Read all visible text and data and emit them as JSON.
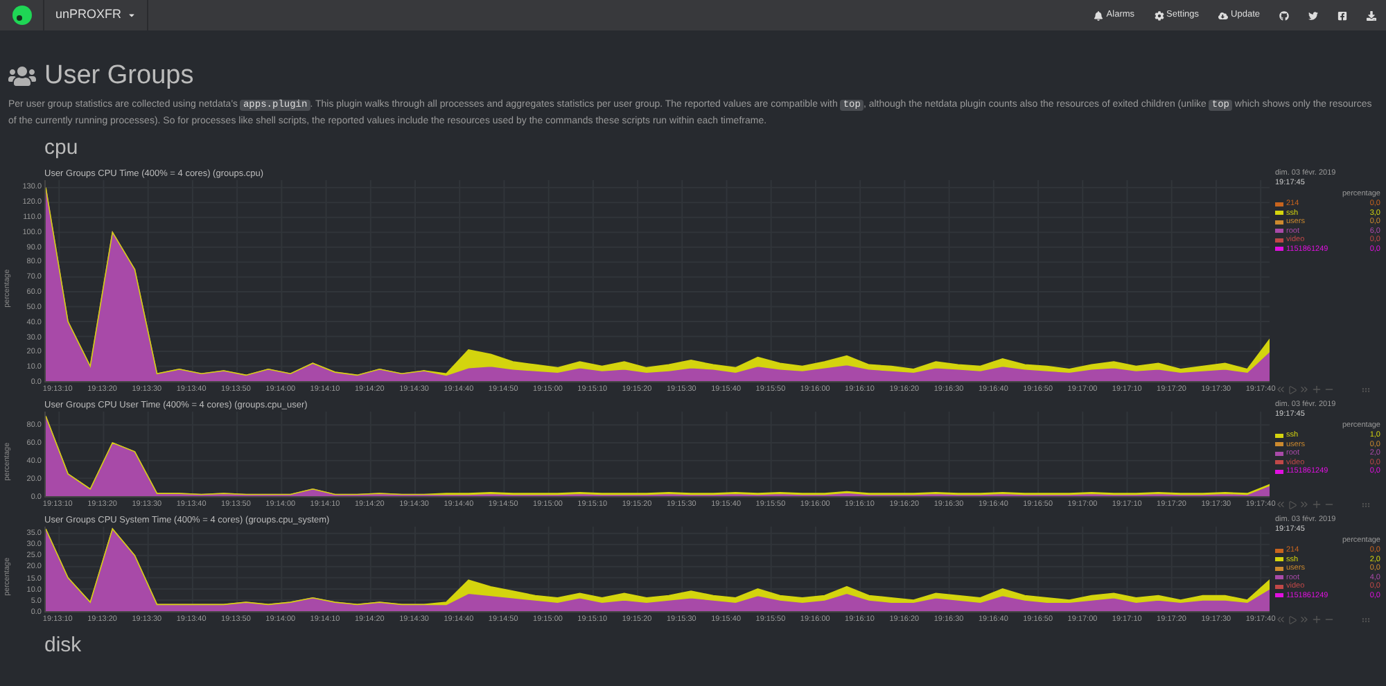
{
  "navbar": {
    "host": "unPROXFR",
    "links": [
      {
        "kind": "alarms",
        "label": "Alarms"
      },
      {
        "kind": "settings",
        "label": "Settings"
      },
      {
        "kind": "update",
        "label": "Update"
      }
    ]
  },
  "page": {
    "title": "User Groups",
    "description": [
      {
        "kind": "text",
        "text": "Per user group statistics are collected using netdata's "
      },
      {
        "kind": "code",
        "text": "apps.plugin"
      },
      {
        "kind": "text",
        "text": ". This plugin walks through all processes and aggregates statistics per user group. The reported values are compatible with "
      },
      {
        "kind": "code",
        "text": "top"
      },
      {
        "kind": "text",
        "text": ", although the netdata plugin counts also the resources of exited children (unlike "
      },
      {
        "kind": "code",
        "text": "top"
      },
      {
        "kind": "text",
        "text": " which shows only the resources of the currently running processes). So for processes like shell scripts, the reported values include the resources used by the commands these scripts run within each timeframe."
      }
    ]
  },
  "sections": [
    {
      "heading": "cpu",
      "charts": [
        {
          "title": "User Groups CPU Time (400% = 4 cores) (groups.cpu)",
          "date": "dim. 03 févr. 2019",
          "time": "19:17:45",
          "unit": "percentage",
          "legend": [
            {
              "kind": "static",
              "name": "214",
              "color": "#c8641e",
              "value": "0,0"
            },
            {
              "kind": "series",
              "value": "3,0"
            },
            {
              "kind": "static",
              "name": "users",
              "color": "#cc8a2e",
              "value": "0,0"
            },
            {
              "kind": "series",
              "value": "6,0"
            },
            {
              "kind": "static",
              "name": "video",
              "color": "#c04848",
              "value": "0,0"
            },
            {
              "kind": "static",
              "name": "1151861249",
              "color": "#e010e0",
              "value": "0,0"
            }
          ],
          "chart_data": {
            "type": "area",
            "stacked": true,
            "grid": true,
            "legend": "right",
            "ylabel": "percentage",
            "xlim": [
              69187,
              69462
            ],
            "ylim": [
              0,
              135
            ],
            "x": [
              69187,
              69192,
              69197,
              69202,
              69207,
              69212,
              69217,
              69222,
              69227,
              69232,
              69237,
              69242,
              69247,
              69252,
              69257,
              69262,
              69267,
              69272,
              69277,
              69282,
              69287,
              69292,
              69297,
              69302,
              69307,
              69312,
              69317,
              69322,
              69327,
              69332,
              69337,
              69342,
              69347,
              69352,
              69357,
              69362,
              69367,
              69372,
              69377,
              69382,
              69387,
              69392,
              69397,
              69402,
              69407,
              69412,
              69417,
              69422,
              69427,
              69432,
              69437,
              69442,
              69447,
              69452,
              69457,
              69462
            ],
            "xticks": [
              {
                "value": 69190,
                "label": "19:13:10"
              },
              {
                "value": 69200,
                "label": "19:13:20"
              },
              {
                "value": 69210,
                "label": "19:13:30"
              },
              {
                "value": 69220,
                "label": "19:13:40"
              },
              {
                "value": 69230,
                "label": "19:13:50"
              },
              {
                "value": 69240,
                "label": "19:14:00"
              },
              {
                "value": 69250,
                "label": "19:14:10"
              },
              {
                "value": 69260,
                "label": "19:14:20"
              },
              {
                "value": 69270,
                "label": "19:14:30"
              },
              {
                "value": 69280,
                "label": "19:14:40"
              },
              {
                "value": 69290,
                "label": "19:14:50"
              },
              {
                "value": 69300,
                "label": "19:15:00"
              },
              {
                "value": 69310,
                "label": "19:15:10"
              },
              {
                "value": 69320,
                "label": "19:15:20"
              },
              {
                "value": 69330,
                "label": "19:15:30"
              },
              {
                "value": 69340,
                "label": "19:15:40"
              },
              {
                "value": 69350,
                "label": "19:15:50"
              },
              {
                "value": 69360,
                "label": "19:16:00"
              },
              {
                "value": 69370,
                "label": "19:16:10"
              },
              {
                "value": 69380,
                "label": "19:16:20"
              },
              {
                "value": 69390,
                "label": "19:16:30"
              },
              {
                "value": 69400,
                "label": "19:16:40"
              },
              {
                "value": 69410,
                "label": "19:16:50"
              },
              {
                "value": 69420,
                "label": "19:17:00"
              },
              {
                "value": 69430,
                "label": "19:17:10"
              },
              {
                "value": 69440,
                "label": "19:17:20"
              },
              {
                "value": 69450,
                "label": "19:17:30"
              },
              {
                "value": 69460,
                "label": "19:17:40"
              }
            ],
            "yticks": [
              {
                "value": 0,
                "label": "0.0"
              },
              {
                "value": 10,
                "label": "10.0"
              },
              {
                "value": 20,
                "label": "20.0"
              },
              {
                "value": 30,
                "label": "30.0"
              },
              {
                "value": 40,
                "label": "40.0"
              },
              {
                "value": 50,
                "label": "50.0"
              },
              {
                "value": 60,
                "label": "60.0"
              },
              {
                "value": 70,
                "label": "70.0"
              },
              {
                "value": 80,
                "label": "80.0"
              },
              {
                "value": 90,
                "label": "90.0"
              },
              {
                "value": 100,
                "label": "100.0"
              },
              {
                "value": 110,
                "label": "110.0"
              },
              {
                "value": 120,
                "label": "120.0"
              },
              {
                "value": 130,
                "label": "130.0"
              }
            ],
            "series": [
              {
                "name": "ssh",
                "color": "#d4d40e",
                "values": [
                  0,
                  0,
                  0,
                  0,
                  0,
                  0,
                  0,
                  0,
                  0,
                  0,
                  0,
                  0,
                  0,
                  0,
                  0,
                  0,
                  0,
                  0,
                  1,
                  12,
                  8,
                  5,
                  4,
                  3,
                  4,
                  3,
                  5,
                  3,
                  4,
                  5,
                  3,
                  3,
                  6,
                  4,
                  3,
                  4,
                  6,
                  3,
                  3,
                  2,
                  4,
                  3,
                  3,
                  5,
                  3,
                  3,
                  2,
                  3,
                  4,
                  3,
                  4,
                  2,
                  3,
                  4,
                  2,
                  8
                ]
              },
              {
                "name": "root",
                "color": "#a84aa8",
                "values": [
                  130,
                  40,
                  10,
                  100,
                  75,
                  5,
                  8,
                  5,
                  7,
                  4,
                  8,
                  5,
                  12,
                  6,
                  4,
                  8,
                  5,
                  7,
                  4,
                  9,
                  10,
                  8,
                  7,
                  6,
                  9,
                  7,
                  8,
                  6,
                  7,
                  9,
                  8,
                  6,
                  10,
                  8,
                  7,
                  9,
                  11,
                  8,
                  7,
                  6,
                  9,
                  8,
                  7,
                  10,
                  8,
                  7,
                  6,
                  8,
                  9,
                  7,
                  8,
                  6,
                  7,
                  8,
                  6,
                  20
                ]
              }
            ]
          }
        },
        {
          "title": "User Groups CPU User Time (400% = 4 cores) (groups.cpu_user)",
          "date": "dim. 03 févr. 2019",
          "time": "19:17:45",
          "unit": "percentage",
          "legend": [
            {
              "kind": "series",
              "value": "1,0"
            },
            {
              "kind": "static",
              "name": "users",
              "color": "#cc8a2e",
              "value": "0,0"
            },
            {
              "kind": "series",
              "value": "2,0"
            },
            {
              "kind": "static",
              "name": "video",
              "color": "#c04848",
              "value": "0,0"
            },
            {
              "kind": "static",
              "name": "1151861249",
              "color": "#e010e0",
              "value": "0,0"
            }
          ],
          "chart_data": {
            "type": "area",
            "stacked": true,
            "grid": true,
            "legend": "right",
            "ylabel": "percentage",
            "xlim": [
              69187,
              69462
            ],
            "ylim": [
              0,
              95
            ],
            "x": [
              69187,
              69192,
              69197,
              69202,
              69207,
              69212,
              69217,
              69222,
              69227,
              69232,
              69237,
              69242,
              69247,
              69252,
              69257,
              69262,
              69267,
              69272,
              69277,
              69282,
              69287,
              69292,
              69297,
              69302,
              69307,
              69312,
              69317,
              69322,
              69327,
              69332,
              69337,
              69342,
              69347,
              69352,
              69357,
              69362,
              69367,
              69372,
              69377,
              69382,
              69387,
              69392,
              69397,
              69402,
              69407,
              69412,
              69417,
              69422,
              69427,
              69432,
              69437,
              69442,
              69447,
              69452,
              69457,
              69462
            ],
            "xticks": [
              {
                "value": 69190,
                "label": "19:13:10"
              },
              {
                "value": 69200,
                "label": "19:13:20"
              },
              {
                "value": 69210,
                "label": "19:13:30"
              },
              {
                "value": 69220,
                "label": "19:13:40"
              },
              {
                "value": 69230,
                "label": "19:13:50"
              },
              {
                "value": 69240,
                "label": "19:14:00"
              },
              {
                "value": 69250,
                "label": "19:14:10"
              },
              {
                "value": 69260,
                "label": "19:14:20"
              },
              {
                "value": 69270,
                "label": "19:14:30"
              },
              {
                "value": 69280,
                "label": "19:14:40"
              },
              {
                "value": 69290,
                "label": "19:14:50"
              },
              {
                "value": 69300,
                "label": "19:15:00"
              },
              {
                "value": 69310,
                "label": "19:15:10"
              },
              {
                "value": 69320,
                "label": "19:15:20"
              },
              {
                "value": 69330,
                "label": "19:15:30"
              },
              {
                "value": 69340,
                "label": "19:15:40"
              },
              {
                "value": 69350,
                "label": "19:15:50"
              },
              {
                "value": 69360,
                "label": "19:16:00"
              },
              {
                "value": 69370,
                "label": "19:16:10"
              },
              {
                "value": 69380,
                "label": "19:16:20"
              },
              {
                "value": 69390,
                "label": "19:16:30"
              },
              {
                "value": 69400,
                "label": "19:16:40"
              },
              {
                "value": 69410,
                "label": "19:16:50"
              },
              {
                "value": 69420,
                "label": "19:17:00"
              },
              {
                "value": 69430,
                "label": "19:17:10"
              },
              {
                "value": 69440,
                "label": "19:17:20"
              },
              {
                "value": 69450,
                "label": "19:17:30"
              },
              {
                "value": 69460,
                "label": "19:17:40"
              }
            ],
            "yticks": [
              {
                "value": 0,
                "label": "0.0"
              },
              {
                "value": 20,
                "label": "20.0"
              },
              {
                "value": 40,
                "label": "40.0"
              },
              {
                "value": 60,
                "label": "60.0"
              },
              {
                "value": 80,
                "label": "80.0"
              }
            ],
            "series": [
              {
                "name": "ssh",
                "color": "#d4d40e",
                "values": [
                  0,
                  0,
                  0,
                  0,
                  0,
                  0,
                  0,
                  0,
                  0,
                  0,
                  0,
                  0,
                  0,
                  0,
                  0,
                  0,
                  0,
                  0,
                  1,
                  1,
                  1,
                  1,
                  1,
                  1,
                  1,
                  1,
                  1,
                  1,
                  1,
                  1,
                  1,
                  1,
                  1,
                  1,
                  1,
                  1,
                  1,
                  1,
                  1,
                  1,
                  1,
                  1,
                  1,
                  1,
                  1,
                  1,
                  1,
                  1,
                  1,
                  1,
                  1,
                  1,
                  1,
                  1,
                  1,
                  1
                ]
              },
              {
                "name": "root",
                "color": "#a84aa8",
                "values": [
                  90,
                  25,
                  8,
                  60,
                  50,
                  3,
                  3,
                  2,
                  3,
                  2,
                  2,
                  2,
                  8,
                  2,
                  2,
                  3,
                  2,
                  2,
                  2,
                  2,
                  3,
                  2,
                  2,
                  2,
                  3,
                  2,
                  2,
                  2,
                  3,
                  2,
                  2,
                  3,
                  2,
                  3,
                  2,
                  2,
                  4,
                  2,
                  2,
                  2,
                  3,
                  2,
                  2,
                  3,
                  2,
                  2,
                  2,
                  3,
                  2,
                  2,
                  3,
                  2,
                  2,
                  3,
                  2,
                  12
                ]
              }
            ]
          }
        },
        {
          "title": "User Groups CPU System Time (400% = 4 cores) (groups.cpu_system)",
          "date": "dim. 03 févr. 2019",
          "time": "19:17:45",
          "unit": "percentage",
          "legend": [
            {
              "kind": "static",
              "name": "214",
              "color": "#c8641e",
              "value": "0,0"
            },
            {
              "kind": "series",
              "value": "2,0"
            },
            {
              "kind": "static",
              "name": "users",
              "color": "#cc8a2e",
              "value": "0,0"
            },
            {
              "kind": "series",
              "value": "4,0"
            },
            {
              "kind": "static",
              "name": "video",
              "color": "#c04848",
              "value": "0,0"
            },
            {
              "kind": "static",
              "name": "1151861249",
              "color": "#e010e0",
              "value": "0,0"
            }
          ],
          "chart_data": {
            "type": "area",
            "stacked": true,
            "grid": true,
            "legend": "right",
            "ylabel": "percentage",
            "xlim": [
              69187,
              69462
            ],
            "ylim": [
              0,
              38
            ],
            "x": [
              69187,
              69192,
              69197,
              69202,
              69207,
              69212,
              69217,
              69222,
              69227,
              69232,
              69237,
              69242,
              69247,
              69252,
              69257,
              69262,
              69267,
              69272,
              69277,
              69282,
              69287,
              69292,
              69297,
              69302,
              69307,
              69312,
              69317,
              69322,
              69327,
              69332,
              69337,
              69342,
              69347,
              69352,
              69357,
              69362,
              69367,
              69372,
              69377,
              69382,
              69387,
              69392,
              69397,
              69402,
              69407,
              69412,
              69417,
              69422,
              69427,
              69432,
              69437,
              69442,
              69447,
              69452,
              69457,
              69462
            ],
            "xticks": [
              {
                "value": 69190,
                "label": "19:13:10"
              },
              {
                "value": 69200,
                "label": "19:13:20"
              },
              {
                "value": 69210,
                "label": "19:13:30"
              },
              {
                "value": 69220,
                "label": "19:13:40"
              },
              {
                "value": 69230,
                "label": "19:13:50"
              },
              {
                "value": 69240,
                "label": "19:14:00"
              },
              {
                "value": 69250,
                "label": "19:14:10"
              },
              {
                "value": 69260,
                "label": "19:14:20"
              },
              {
                "value": 69270,
                "label": "19:14:30"
              },
              {
                "value": 69280,
                "label": "19:14:40"
              },
              {
                "value": 69290,
                "label": "19:14:50"
              },
              {
                "value": 69300,
                "label": "19:15:00"
              },
              {
                "value": 69310,
                "label": "19:15:10"
              },
              {
                "value": 69320,
                "label": "19:15:20"
              },
              {
                "value": 69330,
                "label": "19:15:30"
              },
              {
                "value": 69340,
                "label": "19:15:40"
              },
              {
                "value": 69350,
                "label": "19:15:50"
              },
              {
                "value": 69360,
                "label": "19:16:00"
              },
              {
                "value": 69370,
                "label": "19:16:10"
              },
              {
                "value": 69380,
                "label": "19:16:20"
              },
              {
                "value": 69390,
                "label": "19:16:30"
              },
              {
                "value": 69400,
                "label": "19:16:40"
              },
              {
                "value": 69410,
                "label": "19:16:50"
              },
              {
                "value": 69420,
                "label": "19:17:00"
              },
              {
                "value": 69430,
                "label": "19:17:10"
              },
              {
                "value": 69440,
                "label": "19:17:20"
              },
              {
                "value": 69450,
                "label": "19:17:30"
              },
              {
                "value": 69460,
                "label": "19:17:40"
              }
            ],
            "yticks": [
              {
                "value": 0,
                "label": "0.0"
              },
              {
                "value": 5,
                "label": "5.0"
              },
              {
                "value": 10,
                "label": "10.0"
              },
              {
                "value": 15,
                "label": "15.0"
              },
              {
                "value": 20,
                "label": "20.0"
              },
              {
                "value": 25,
                "label": "25.0"
              },
              {
                "value": 30,
                "label": "30.0"
              },
              {
                "value": 35,
                "label": "35.0"
              }
            ],
            "series": [
              {
                "name": "ssh",
                "color": "#d4d40e",
                "values": [
                  0,
                  0,
                  0,
                  0,
                  0,
                  0,
                  0,
                  0,
                  0,
                  0,
                  0,
                  0,
                  0,
                  0,
                  0,
                  0,
                  0,
                  0,
                  1,
                  6,
                  4,
                  3,
                  2,
                  2,
                  2,
                  2,
                  3,
                  2,
                  2,
                  3,
                  2,
                  2,
                  3,
                  2,
                  2,
                  2,
                  3,
                  2,
                  2,
                  1,
                  2,
                  2,
                  2,
                  3,
                  2,
                  2,
                  1,
                  2,
                  2,
                  2,
                  2,
                  1,
                  2,
                  2,
                  1,
                  4
                ]
              },
              {
                "name": "root",
                "color": "#a84aa8",
                "values": [
                  37,
                  15,
                  4,
                  37,
                  25,
                  3,
                  3,
                  3,
                  3,
                  4,
                  3,
                  4,
                  6,
                  4,
                  3,
                  4,
                  3,
                  3,
                  3,
                  8,
                  7,
                  6,
                  5,
                  4,
                  6,
                  4,
                  5,
                  4,
                  5,
                  6,
                  5,
                  4,
                  7,
                  5,
                  4,
                  5,
                  8,
                  5,
                  4,
                  4,
                  6,
                  5,
                  4,
                  7,
                  5,
                  4,
                  4,
                  5,
                  6,
                  4,
                  5,
                  4,
                  5,
                  5,
                  4,
                  10
                ]
              }
            ]
          }
        }
      ]
    },
    {
      "heading": "disk"
    }
  ]
}
